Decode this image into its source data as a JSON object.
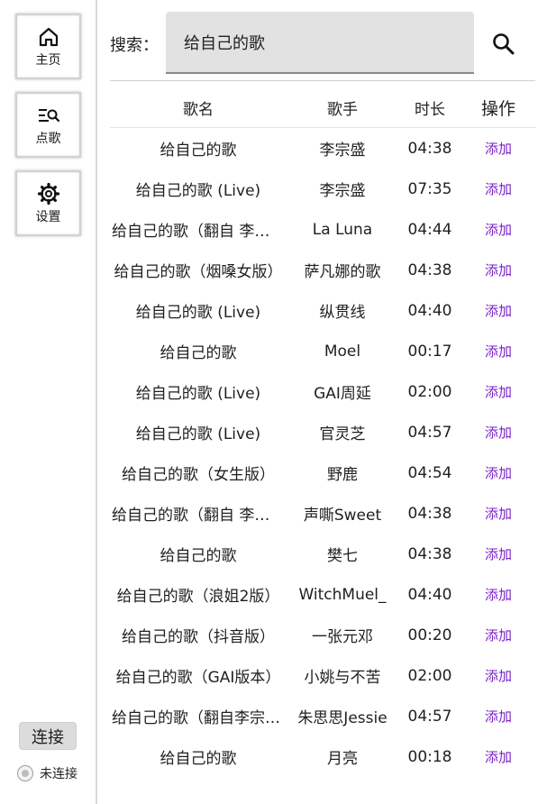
{
  "sidebar": {
    "items": [
      {
        "label": "主页",
        "icon": "home-icon"
      },
      {
        "label": "点歌",
        "icon": "song-search-icon"
      },
      {
        "label": "设置",
        "icon": "gear-icon"
      }
    ],
    "connect_label": "连接",
    "status_label": "未连接"
  },
  "search": {
    "label": "搜索：",
    "value": "给自己的歌",
    "button_icon": "search-icon"
  },
  "table": {
    "headers": {
      "name": "歌名",
      "artist": "歌手",
      "duration": "时长",
      "action": "操作"
    },
    "action_label": "添加",
    "action_color": "#7a1fc9",
    "rows": [
      {
        "name": "给自己的歌",
        "artist": "李宗盛",
        "duration": "04:38"
      },
      {
        "name": "给自己的歌 (Live)",
        "artist": "李宗盛",
        "duration": "07:35"
      },
      {
        "name": "给自己的歌（翻自 李宗盛）",
        "artist": "La Luna",
        "duration": "04:44"
      },
      {
        "name": "给自己的歌（烟嗓女版）",
        "artist": "萨凡娜的歌",
        "duration": "04:38"
      },
      {
        "name": "给自己的歌 (Live)",
        "artist": "纵贯线",
        "duration": "04:40"
      },
      {
        "name": "给自己的歌",
        "artist": "Moel",
        "duration": "00:17"
      },
      {
        "name": "给自己的歌 (Live)",
        "artist": "GAI周延",
        "duration": "02:00"
      },
      {
        "name": "给自己的歌 (Live)",
        "artist": "官灵芝",
        "duration": "04:57"
      },
      {
        "name": "给自己的歌（女生版）",
        "artist": "野鹿",
        "duration": "04:54"
      },
      {
        "name": "给自己的歌（翻自 李宗盛）",
        "artist": "声嘶Sweet",
        "duration": "04:38"
      },
      {
        "name": "给自己的歌",
        "artist": "樊七",
        "duration": "04:38"
      },
      {
        "name": "给自己的歌（浪姐2版）",
        "artist": "WitchMuel_",
        "duration": "04:40"
      },
      {
        "name": "给自己的歌（抖音版）",
        "artist": "一张元邓",
        "duration": "00:20"
      },
      {
        "name": "给自己的歌（GAI版本）",
        "artist": "小姚与不苦",
        "duration": "02:00"
      },
      {
        "name": "给自己的歌（翻自李宗盛）",
        "artist": "朱思思Jessie",
        "duration": "04:57"
      },
      {
        "name": "给自己的歌",
        "artist": "月亮",
        "duration": "00:18"
      }
    ]
  }
}
